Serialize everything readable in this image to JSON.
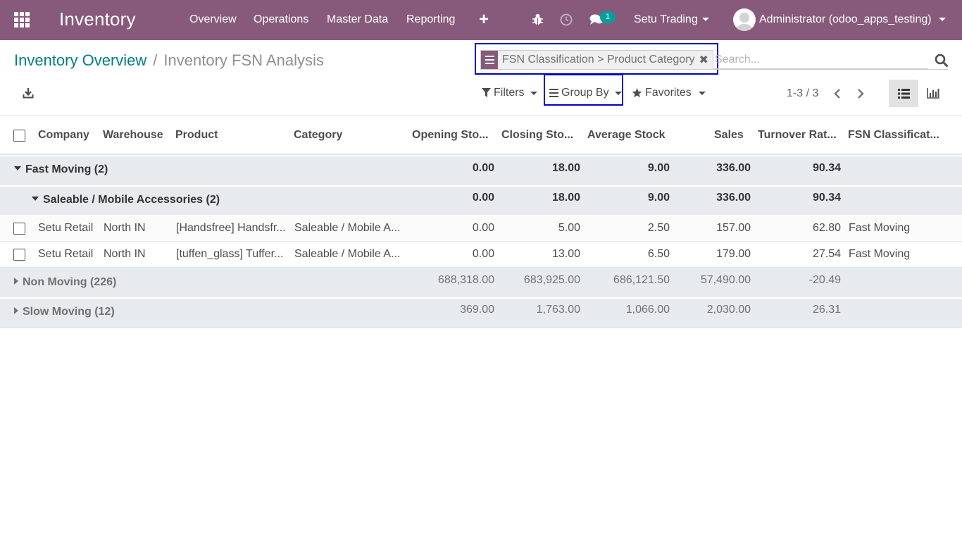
{
  "navbar": {
    "app_title": "Inventory",
    "menu": [
      "Overview",
      "Operations",
      "Master Data",
      "Reporting"
    ],
    "plus": "+",
    "chat_badge": "1",
    "company": "Setu Trading",
    "user": "Administrator (odoo_apps_testing)",
    "bg_color": "#875a7b"
  },
  "breadcrumb": {
    "parent": "Inventory Overview",
    "separator": "/",
    "current": "Inventory FSN Analysis"
  },
  "search": {
    "facet": "FSN Classification > Product Category",
    "placeholder": "Search..."
  },
  "toolbar": {
    "filters": "Filters",
    "group_by": "Group By",
    "favorites": "Favorites",
    "pager": "1-3 / 3"
  },
  "table": {
    "headers": [
      "Company",
      "Warehouse",
      "Product",
      "Category",
      "Opening Sto...",
      "Closing Sto...",
      "Average Stock",
      "Sales",
      "Turnover Rat...",
      "FSN Classificat..."
    ],
    "groups": [
      {
        "label": "Fast Moving (2)",
        "opening": "0.00",
        "closing": "18.00",
        "average": "9.00",
        "sales": "336.00",
        "turnover": "90.34",
        "subgroup": {
          "label": "Saleable / Mobile Accessories (2)",
          "opening": "0.00",
          "closing": "18.00",
          "average": "9.00",
          "sales": "336.00",
          "turnover": "90.34"
        },
        "rows": [
          {
            "company": "Setu Retail",
            "warehouse": "North IN",
            "product": "[Handsfree] Handsfr...",
            "category": "Saleable / Mobile A...",
            "opening": "0.00",
            "closing": "5.00",
            "average": "2.50",
            "sales": "157.00",
            "turnover": "62.80",
            "fsn": "Fast Moving"
          },
          {
            "company": "Setu Retail",
            "warehouse": "North IN",
            "product": "[tuffen_glass] Tuffer...",
            "category": "Saleable / Mobile A...",
            "opening": "0.00",
            "closing": "13.00",
            "average": "6.50",
            "sales": "179.00",
            "turnover": "27.54",
            "fsn": "Fast Moving"
          }
        ]
      },
      {
        "label": "Non Moving (226)",
        "opening": "688,318.00",
        "closing": "683,925.00",
        "average": "686,121.50",
        "sales": "57,490.00",
        "turnover": "-20.49"
      },
      {
        "label": "Slow Moving (12)",
        "opening": "369.00",
        "closing": "1,763.00",
        "average": "1,066.00",
        "sales": "2,030.00",
        "turnover": "26.31"
      }
    ]
  }
}
